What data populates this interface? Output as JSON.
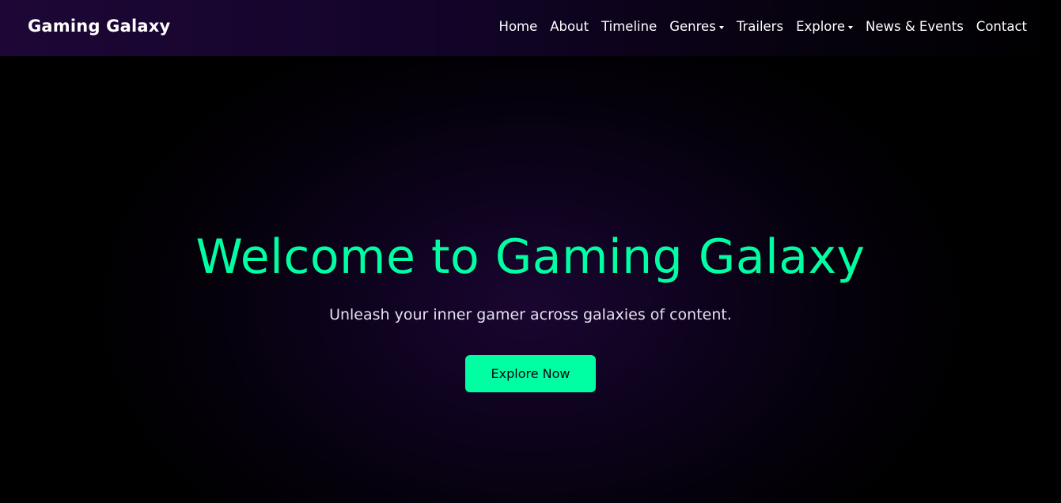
{
  "navbar": {
    "brand": "Gaming Galaxy",
    "links": [
      {
        "label": "Home",
        "dropdown": false
      },
      {
        "label": "About",
        "dropdown": false
      },
      {
        "label": "Timeline",
        "dropdown": false
      },
      {
        "label": "Genres",
        "dropdown": true
      },
      {
        "label": "Trailers",
        "dropdown": false
      },
      {
        "label": "Explore",
        "dropdown": true
      },
      {
        "label": "News & Events",
        "dropdown": false
      },
      {
        "label": "Contact",
        "dropdown": false
      }
    ]
  },
  "hero": {
    "title": "Welcome to Gaming Galaxy",
    "subtitle": "Unleash your inner gamer across galaxies of content.",
    "cta_label": "Explore Now"
  },
  "colors": {
    "accent": "#00ffa3",
    "background": "#000000",
    "navbar_purple": "#1e0736",
    "text": "#ffffff"
  }
}
